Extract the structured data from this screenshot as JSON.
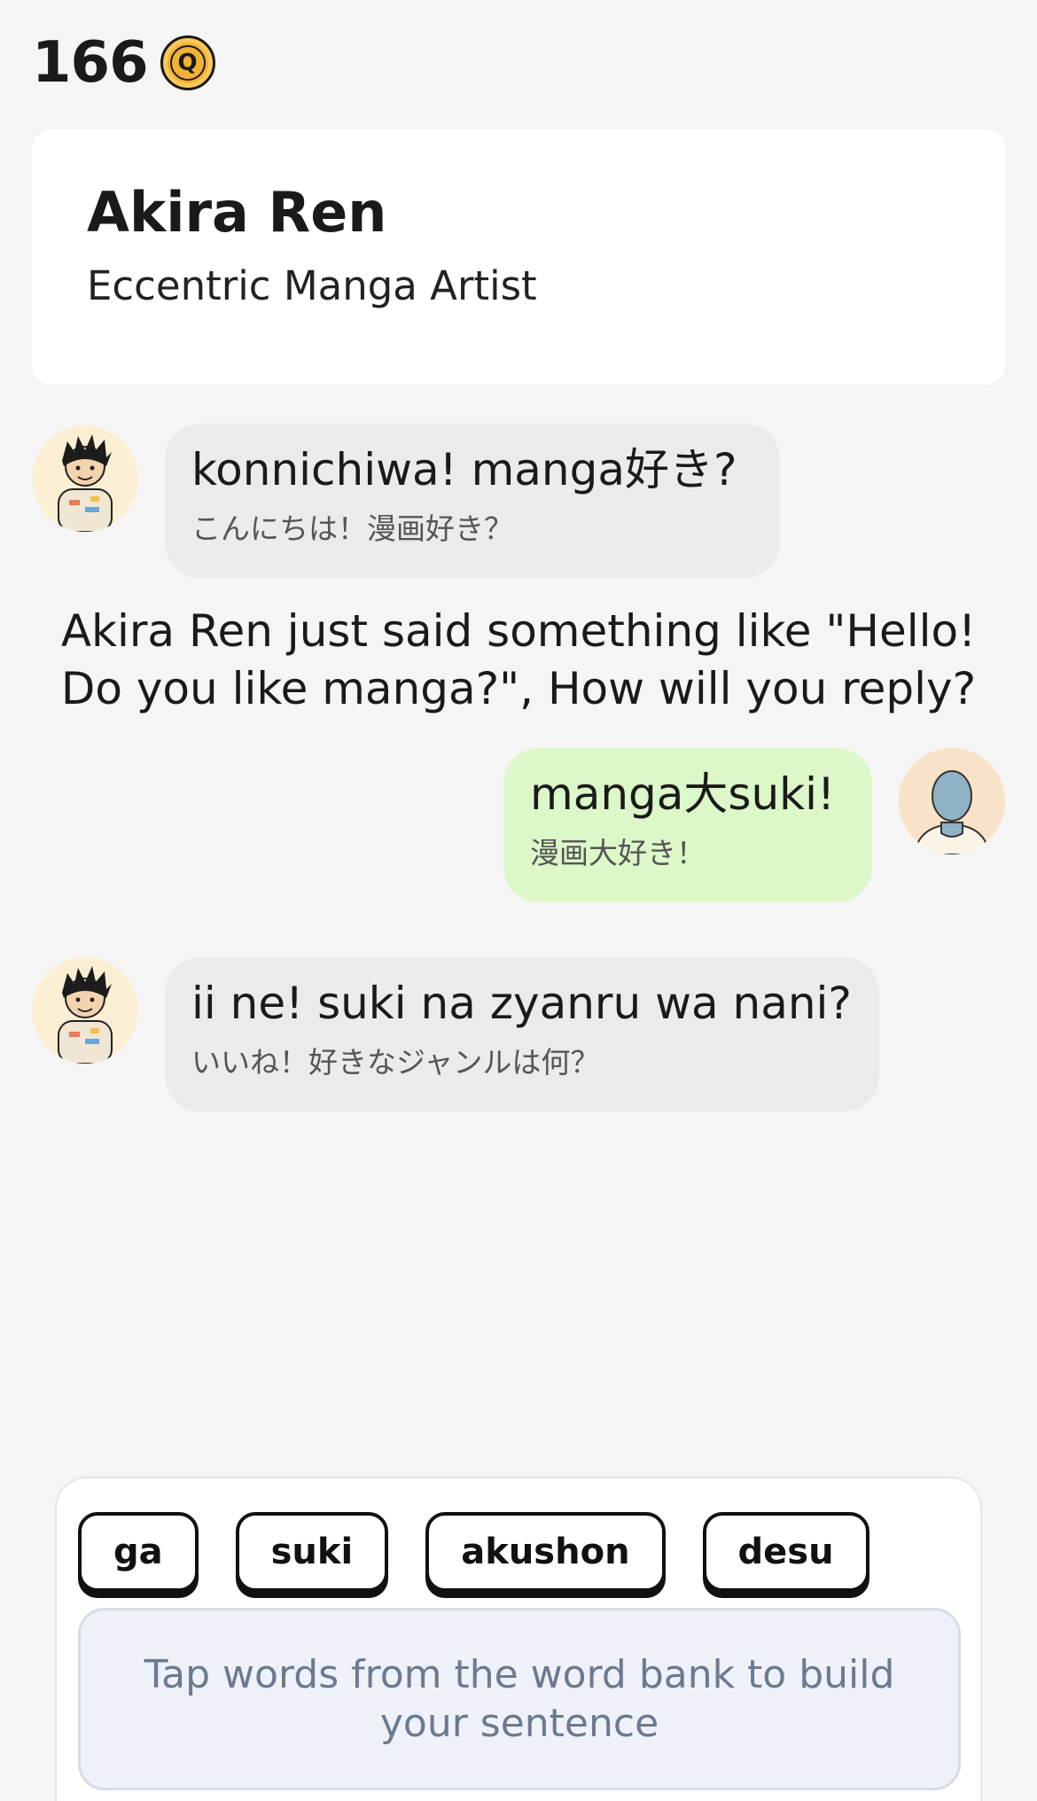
{
  "coins": {
    "count": "166",
    "icon": "coin-icon",
    "symbol": "Q"
  },
  "character": {
    "name": "Akira Ren",
    "role": "Eccentric Manga Artist"
  },
  "messages": [
    {
      "from": "character",
      "romaji": "konnichiwa! manga好き?",
      "kana": "こんにちは！漫画好き？"
    },
    {
      "from": "user",
      "romaji": "manga大suki!",
      "kana": "漫画大好き！"
    },
    {
      "from": "character",
      "romaji": "ii ne! suki na zyanru wa nani?",
      "kana": "いいね！好きなジャンルは何？"
    }
  ],
  "prompt": "Akira Ren just said something like \"Hello! Do you like manga?\", How will you reply?",
  "word_bank": {
    "words": [
      "ga",
      "suki",
      "akushon",
      "desu"
    ],
    "placeholder": "Tap words from the word bank to build your sentence"
  },
  "colors": {
    "background": "#f5f5f5",
    "bot_bubble": "#ebebeb",
    "user_bubble": "#dcf7c8",
    "coin": "#f2b233"
  }
}
